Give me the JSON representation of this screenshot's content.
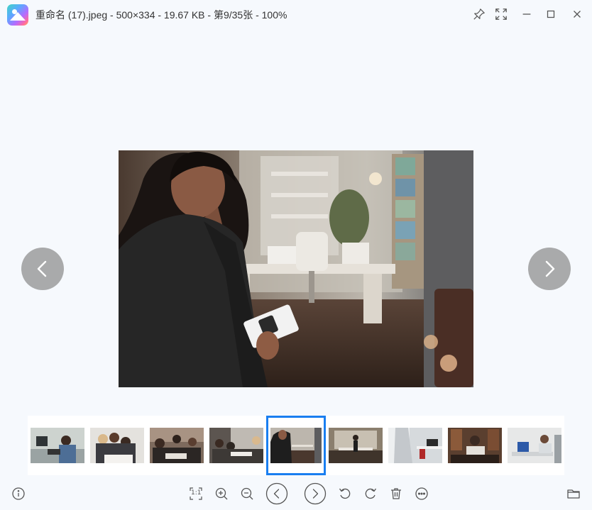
{
  "titlebar": {
    "title": "重命名 (17).jpeg - 500×334 - 19.67 KB - 第9/35张 - 100%"
  },
  "icons": {
    "app": "photo-viewer-app-icon",
    "pin": "pin-icon",
    "fullscreen": "fullscreen-icon",
    "minimize": "minimize-icon",
    "maximize": "maximize-icon",
    "close": "close-icon",
    "prev": "chevron-left-icon",
    "next": "chevron-right-icon"
  },
  "colors": {
    "background": "#f6f9fd",
    "accent": "#1a7ef0",
    "nav_arrow": "#969696"
  },
  "thumbnails": {
    "count_visible": 9,
    "selected_index": 4
  },
  "toolbar": {
    "info": "info-icon",
    "actual_size": "1:1",
    "zoom_in": "zoom-in-icon",
    "zoom_out": "zoom-out-icon",
    "previous": "previous-circle-icon",
    "next": "next-circle-icon",
    "rotate_left": "rotate-left-icon",
    "rotate_right": "rotate-right-icon",
    "delete": "trash-icon",
    "more": "more-icon",
    "open_folder": "folder-icon"
  }
}
